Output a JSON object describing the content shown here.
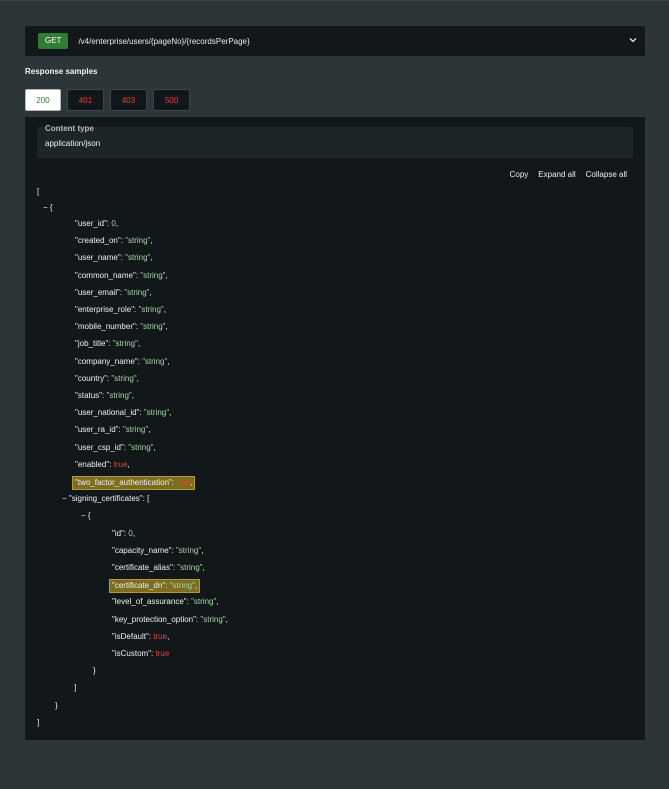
{
  "endpoint": {
    "method": "GET",
    "path": "/v4/enterprise/users/{pageNo}/{recordsPerPage}"
  },
  "samples": {
    "title": "Response samples",
    "tabs": [
      "200",
      "401",
      "403",
      "500"
    ]
  },
  "content_type": {
    "label": "Content type",
    "value": "application/json"
  },
  "actions": {
    "copy": "Copy",
    "expand": "Expand all",
    "collapse": "Collapse all"
  },
  "json": {
    "user_fields": [
      {
        "key": "\"user_id\"",
        "value": "0",
        "type": "num"
      },
      {
        "key": "\"created_on\"",
        "value": "\"string\"",
        "type": "str"
      },
      {
        "key": "\"user_name\"",
        "value": "\"string\"",
        "type": "str"
      },
      {
        "key": "\"common_name\"",
        "value": "\"string\"",
        "type": "str"
      },
      {
        "key": "\"user_email\"",
        "value": "\"string\"",
        "type": "str"
      },
      {
        "key": "\"enterprise_role\"",
        "value": "\"string\"",
        "type": "str"
      },
      {
        "key": "\"mobile_number\"",
        "value": "\"string\"",
        "type": "str"
      },
      {
        "key": "\"job_title\"",
        "value": "\"string\"",
        "type": "str"
      },
      {
        "key": "\"company_name\"",
        "value": "\"string\"",
        "type": "str"
      },
      {
        "key": "\"country\"",
        "value": "\"string\"",
        "type": "str"
      },
      {
        "key": "\"status\"",
        "value": "\"string\"",
        "type": "str"
      },
      {
        "key": "\"user_national_id\"",
        "value": "\"string\"",
        "type": "str"
      },
      {
        "key": "\"user_ra_id\"",
        "value": "\"string\"",
        "type": "str"
      },
      {
        "key": "\"user_csp_id\"",
        "value": "\"string\"",
        "type": "str"
      },
      {
        "key": "\"enabled\"",
        "value": "true",
        "type": "bool"
      },
      {
        "key": "\"two_factor_authentication\"",
        "value": "true",
        "type": "bool",
        "highlight": true
      }
    ],
    "signing_key": "\"signing_certificates\"",
    "cert_fields": [
      {
        "key": "\"id\"",
        "value": "0",
        "type": "num"
      },
      {
        "key": "\"capacity_name\"",
        "value": "\"string\"",
        "type": "str"
      },
      {
        "key": "\"certificate_alias\"",
        "value": "\"string\"",
        "type": "str"
      },
      {
        "key": "\"certificate_dn\"",
        "value": "\"string\"",
        "type": "str",
        "highlight": true
      },
      {
        "key": "\"level_of_assurance\"",
        "value": "\"string\"",
        "type": "str"
      },
      {
        "key": "\"key_protection_option\"",
        "value": "\"string\"",
        "type": "str"
      },
      {
        "key": "\"isDefault\"",
        "value": "true",
        "type": "bool"
      },
      {
        "key": "\"isCustom\"",
        "value": "true",
        "type": "bool",
        "last": true
      }
    ]
  }
}
